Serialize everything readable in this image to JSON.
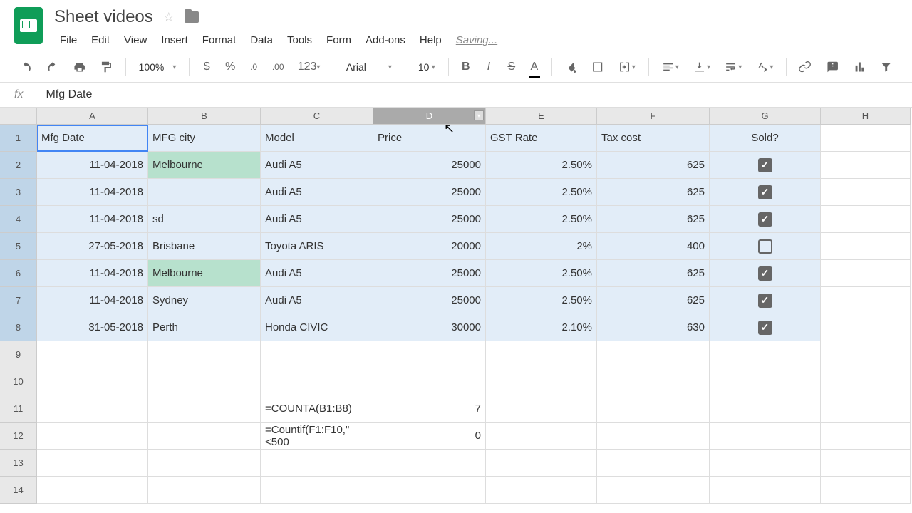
{
  "doc": {
    "title": "Sheet videos",
    "saving": "Saving..."
  },
  "menu": {
    "file": "File",
    "edit": "Edit",
    "view": "View",
    "insert": "Insert",
    "format": "Format",
    "data": "Data",
    "tools": "Tools",
    "form": "Form",
    "addons": "Add-ons",
    "help": "Help"
  },
  "toolbar": {
    "zoom": "100%",
    "font": "Arial",
    "size": "10",
    "number_format": "123",
    "decimal_dec": ".0",
    "decimal_inc": ".00"
  },
  "formula": {
    "fx": "fx",
    "value": "Mfg Date"
  },
  "columns": [
    "A",
    "B",
    "C",
    "D",
    "E",
    "F",
    "G",
    "H"
  ],
  "headers": {
    "A": "Mfg Date",
    "B": "MFG city",
    "C": "Model",
    "D": "Price",
    "E": "GST Rate",
    "F": "Tax cost",
    "G": "Sold?"
  },
  "rows": [
    {
      "A": "11-04-2018",
      "B": "Melbourne",
      "C": "Audi A5",
      "D": "25000",
      "E": "2.50%",
      "F": "625",
      "G": true
    },
    {
      "A": "11-04-2018",
      "B": "",
      "C": "Audi A5",
      "D": "25000",
      "E": "2.50%",
      "F": "625",
      "G": true
    },
    {
      "A": "11-04-2018",
      "B": "sd",
      "C": "Audi A5",
      "D": "25000",
      "E": "2.50%",
      "F": "625",
      "G": true
    },
    {
      "A": "27-05-2018",
      "B": "Brisbane",
      "C": "Toyota ARIS",
      "D": "20000",
      "E": "2%",
      "F": "400",
      "G": false
    },
    {
      "A": "11-04-2018",
      "B": "Melbourne",
      "C": "Audi A5",
      "D": "25000",
      "E": "2.50%",
      "F": "625",
      "G": true
    },
    {
      "A": "11-04-2018",
      "B": "Sydney",
      "C": "Audi A5",
      "D": "25000",
      "E": "2.50%",
      "F": "625",
      "G": true
    },
    {
      "A": "31-05-2018",
      "B": "Perth",
      "C": "Honda CIVIC",
      "D": "30000",
      "E": "2.10%",
      "F": "630",
      "G": true
    }
  ],
  "formulas": {
    "r11c": "=COUNTA(B1:B8)",
    "r11d": "7",
    "r12c": "=Countif(F1:F10,\"<500",
    "r12d": "0"
  },
  "highlighted_b_rows": [
    0,
    4
  ]
}
